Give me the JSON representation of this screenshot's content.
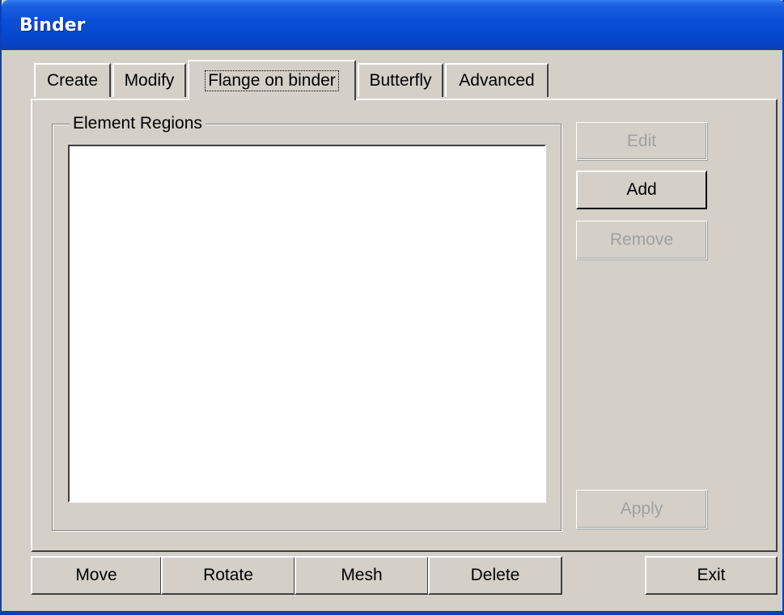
{
  "window": {
    "title": "Binder"
  },
  "tabs": [
    {
      "label": "Create",
      "active": false
    },
    {
      "label": "Modify",
      "active": false
    },
    {
      "label": "Flange on binder",
      "active": true
    },
    {
      "label": "Butterfly",
      "active": false
    },
    {
      "label": "Advanced",
      "active": false
    }
  ],
  "element_regions": {
    "label": "Element Regions",
    "items": []
  },
  "side_buttons": {
    "edit": {
      "label": "Edit",
      "enabled": false
    },
    "add": {
      "label": "Add",
      "enabled": true
    },
    "remove": {
      "label": "Remove",
      "enabled": false
    },
    "apply": {
      "label": "Apply",
      "enabled": false
    }
  },
  "bottom_buttons": {
    "move": "Move",
    "rotate": "Rotate",
    "mesh": "Mesh",
    "delete": "Delete",
    "exit": "Exit"
  },
  "colors": {
    "titlebar": "#0546cc",
    "face": "#d4d0c8",
    "disabled_text": "#a0a0a0"
  }
}
